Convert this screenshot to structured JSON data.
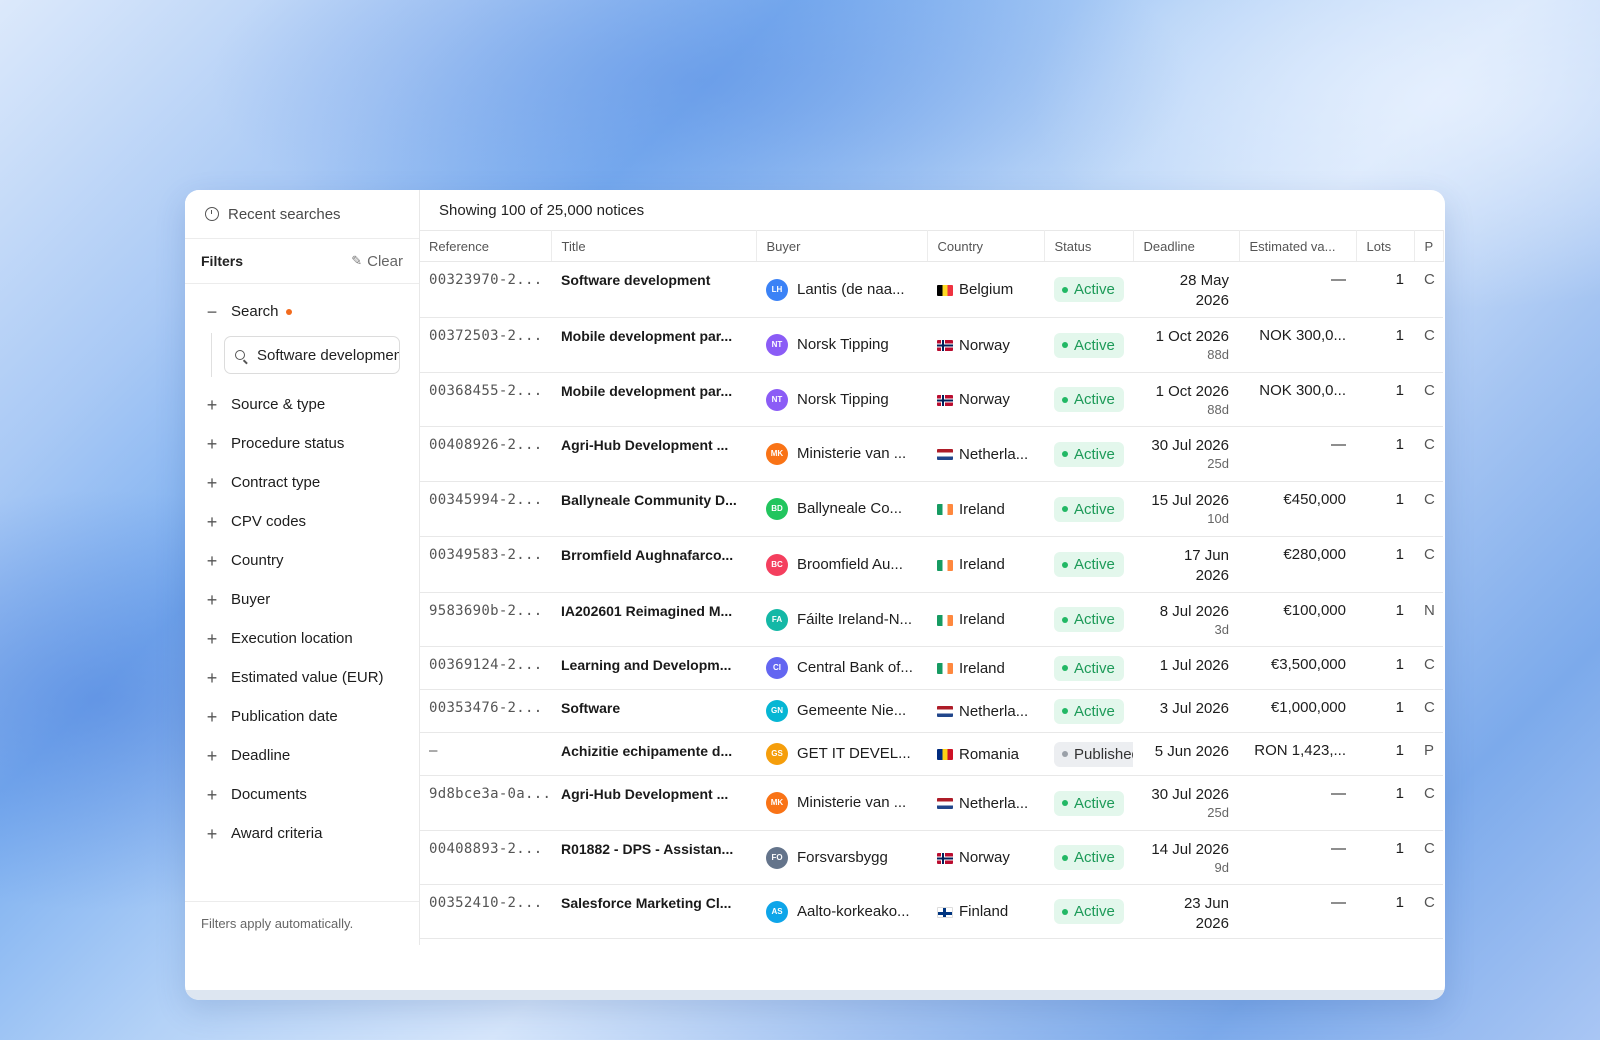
{
  "sidebar": {
    "recent_label": "Recent searches",
    "filters_title": "Filters",
    "clear_label": "Clear",
    "search_label": "Search",
    "search_value": "Software development",
    "items": [
      {
        "label": "Source & type"
      },
      {
        "label": "Procedure status"
      },
      {
        "label": "Contract type"
      },
      {
        "label": "CPV codes"
      },
      {
        "label": "Country"
      },
      {
        "label": "Buyer"
      },
      {
        "label": "Execution location"
      },
      {
        "label": "Estimated value (EUR)"
      },
      {
        "label": "Publication date"
      },
      {
        "label": "Deadline"
      },
      {
        "label": "Documents"
      },
      {
        "label": "Award criteria"
      }
    ],
    "footer": "Filters apply automatically."
  },
  "main": {
    "showing": "Showing 100 of 25,000 notices",
    "columns": [
      "Reference",
      "Title",
      "Buyer",
      "Country",
      "Status",
      "Deadline",
      "Estimated va...",
      "Lots",
      "P"
    ]
  },
  "colors": {
    "nl": [
      "#ae1c28",
      "#ffffff",
      "#21468b"
    ],
    "no": [
      "#ba0c2f",
      "#ffffff",
      "#00205b"
    ],
    "ie": [
      "#169b62",
      "#ffffff",
      "#ff883e"
    ],
    "be": [
      "#000000",
      "#fdda24",
      "#ef3340"
    ],
    "ro": [
      "#002b7f",
      "#fcd116",
      "#ce1126"
    ],
    "fi": [
      "#ffffff",
      "#003580"
    ]
  },
  "rows": [
    {
      "ref": "00323970-2...",
      "title": "Software development",
      "av": "LH",
      "avc": "#3b82f6",
      "buyer": "Lantis (de naa...",
      "flag": "be",
      "country": "Belgium",
      "status": "Active",
      "deadline": "28 May",
      "deadline2": "2026",
      "days": "",
      "value": "—",
      "lots": "1",
      "extra": "C"
    },
    {
      "ref": "00372503-2...",
      "title": "Mobile development par...",
      "av": "NT",
      "avc": "#8b5cf6",
      "buyer": "Norsk Tipping",
      "flag": "no",
      "country": "Norway",
      "status": "Active",
      "deadline": "1 Oct 2026",
      "deadline2": "",
      "days": "88d",
      "value": "NOK 300,0...",
      "lots": "1",
      "extra": "C"
    },
    {
      "ref": "00368455-2...",
      "title": "Mobile development par...",
      "av": "NT",
      "avc": "#8b5cf6",
      "buyer": "Norsk Tipping",
      "flag": "no",
      "country": "Norway",
      "status": "Active",
      "deadline": "1 Oct 2026",
      "deadline2": "",
      "days": "88d",
      "value": "NOK 300,0...",
      "lots": "1",
      "extra": "C"
    },
    {
      "ref": "00408926-2...",
      "title": "Agri-Hub Development ...",
      "av": "MK",
      "avc": "#f97316",
      "buyer": "Ministerie van ...",
      "flag": "nl",
      "country": "Netherla...",
      "status": "Active",
      "deadline": "30 Jul 2026",
      "deadline2": "",
      "days": "25d",
      "value": "—",
      "lots": "1",
      "extra": "C"
    },
    {
      "ref": "00345994-2...",
      "title": "Ballyneale Community D...",
      "av": "BD",
      "avc": "#22c55e",
      "buyer": "Ballyneale Co...",
      "flag": "ie",
      "country": "Ireland",
      "status": "Active",
      "deadline": "15 Jul 2026",
      "deadline2": "",
      "days": "10d",
      "value": "€450,000",
      "lots": "1",
      "extra": "C"
    },
    {
      "ref": "00349583-2...",
      "title": "Brromfield Aughnafarco...",
      "av": "BC",
      "avc": "#f43f5e",
      "buyer": "Broomfield Au...",
      "flag": "ie",
      "country": "Ireland",
      "status": "Active",
      "deadline": "17 Jun",
      "deadline2": "2026",
      "days": "",
      "value": "€280,000",
      "lots": "1",
      "extra": "C"
    },
    {
      "ref": "9583690b-2...",
      "title": "IA202601 Reimagined M...",
      "av": "FA",
      "avc": "#14b8a6",
      "buyer": "Fáilte Ireland-N...",
      "flag": "ie",
      "country": "Ireland",
      "status": "Active",
      "deadline": "8 Jul 2026",
      "deadline2": "",
      "days": "3d",
      "value": "€100,000",
      "lots": "1",
      "extra": "N"
    },
    {
      "ref": "00369124-2...",
      "title": "Learning and Developm...",
      "av": "CI",
      "avc": "#6366f1",
      "buyer": "Central Bank of...",
      "flag": "ie",
      "country": "Ireland",
      "status": "Active",
      "deadline": "1 Jul 2026",
      "deadline2": "",
      "days": "",
      "value": "€3,500,000",
      "lots": "1",
      "extra": "C"
    },
    {
      "ref": "00353476-2...",
      "title": "Software",
      "av": "GN",
      "avc": "#06b6d4",
      "buyer": "Gemeente Nie...",
      "flag": "nl",
      "country": "Netherla...",
      "status": "Active",
      "deadline": "3 Jul 2026",
      "deadline2": "",
      "days": "",
      "value": "€1,000,000",
      "lots": "1",
      "extra": "C"
    },
    {
      "ref": "—",
      "title": "Achizitie echipamente d...",
      "av": "GS",
      "avc": "#f59e0b",
      "buyer": "GET IT DEVEL...",
      "flag": "ro",
      "country": "Romania",
      "status": "Published",
      "deadline": "5 Jun 2026",
      "deadline2": "",
      "days": "",
      "value": "RON 1,423,...",
      "lots": "1",
      "extra": "P"
    },
    {
      "ref": "9d8bce3a-0a...",
      "title": "Agri-Hub Development ...",
      "av": "MK",
      "avc": "#f97316",
      "buyer": "Ministerie van ...",
      "flag": "nl",
      "country": "Netherla...",
      "status": "Active",
      "deadline": "30 Jul 2026",
      "deadline2": "",
      "days": "25d",
      "value": "—",
      "lots": "1",
      "extra": "C"
    },
    {
      "ref": "00408893-2...",
      "title": "R01882 - DPS - Assistan...",
      "av": "FO",
      "avc": "#64748b",
      "buyer": "Forsvarsbygg",
      "flag": "no",
      "country": "Norway",
      "status": "Active",
      "deadline": "14 Jul 2026",
      "deadline2": "",
      "days": "9d",
      "value": "—",
      "lots": "1",
      "extra": "C"
    },
    {
      "ref": "00352410-2...",
      "title": "Salesforce Marketing Cl...",
      "av": "AS",
      "avc": "#0ea5e9",
      "buyer": "Aalto-korkeako...",
      "flag": "fi",
      "country": "Finland",
      "status": "Active",
      "deadline": "23 Jun",
      "deadline2": "2026",
      "days": "",
      "value": "—",
      "lots": "1",
      "extra": "C"
    }
  ]
}
